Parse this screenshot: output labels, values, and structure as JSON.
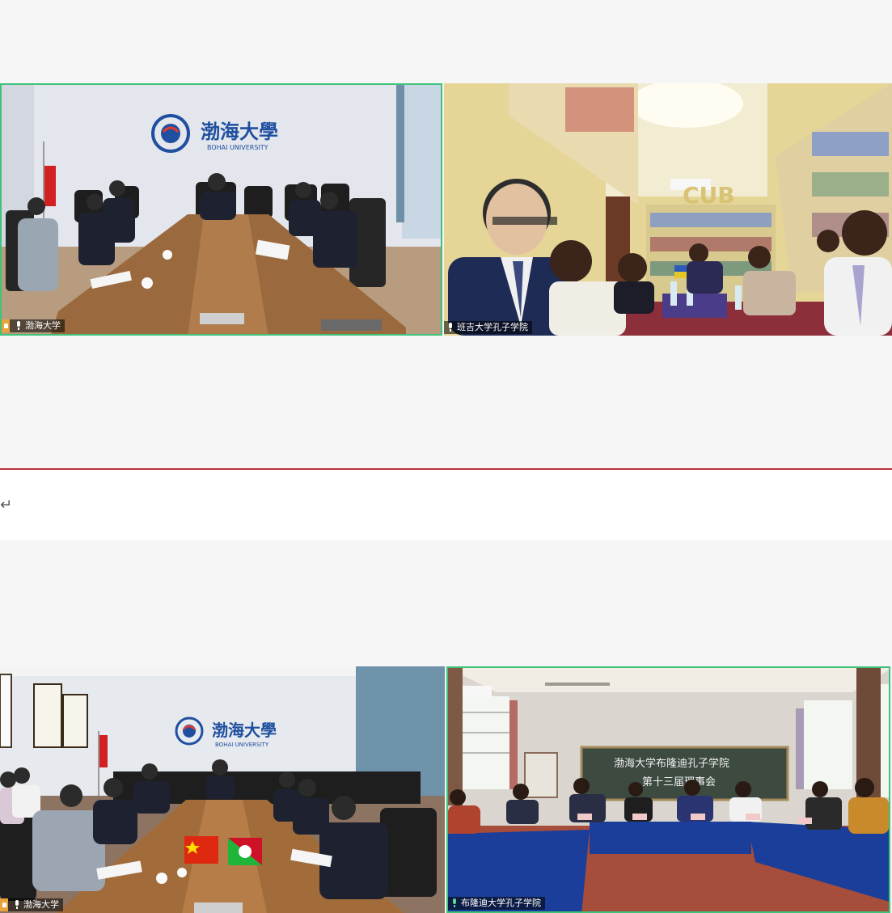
{
  "return_mark": "↵",
  "meeting_1": {
    "tiles": [
      {
        "participant": "渤海大学",
        "is_host": true,
        "speaking": false,
        "wall_sign_cn": "渤海大學",
        "wall_sign_en": "BOHAI   UNIVERSITY"
      },
      {
        "participant": "班吉大学孔子学院",
        "is_host": false,
        "speaking": false,
        "wall_sign": "CUB"
      }
    ]
  },
  "meeting_2": {
    "tiles": [
      {
        "participant": "渤海大学",
        "is_host": true,
        "speaking": false,
        "wall_sign_cn": "渤海大學",
        "wall_sign_en": "BOHAI   UNIVERSITY"
      },
      {
        "participant": "布隆迪大学孔子学院",
        "is_host": false,
        "speaking": true,
        "board_line_1": "渤海大学布隆迪孔子学院",
        "board_line_2": "第十三届理事会"
      }
    ]
  },
  "colors": {
    "active_border": "#3fc27a",
    "divider": "#b8313c",
    "host_badge": "#e8a33c",
    "table_cloth": "#1b3e9a"
  }
}
